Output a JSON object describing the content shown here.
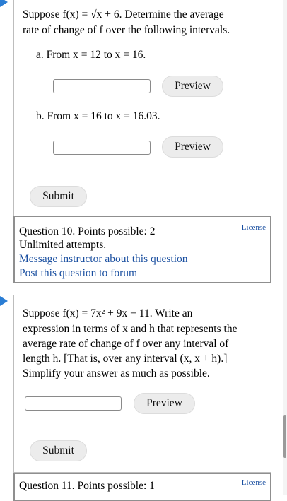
{
  "q9": {
    "intro_line1": "Suppose f(x) = √x + 6. Determine the average",
    "intro_line2": "rate of change of f over the following intervals.",
    "part_a": "a. From x = 12 to x = 16.",
    "part_b": "b. From x = 16 to x = 16.03.",
    "preview_label": "Preview",
    "submit_label": "Submit"
  },
  "q10": {
    "title": "Question 10. Points possible: 2",
    "attempts": "Unlimited attempts.",
    "message_link": "Message instructor about this question",
    "forum_link": "Post this question to forum",
    "license": "License"
  },
  "q11": {
    "lines": [
      "Suppose f(x) = 7x² + 9x − 11. Write an",
      "expression in terms of x and h that represents the",
      "average rate of change of f over any interval of",
      "length h. [That is, over any interval (x, x + h).]",
      "Simplify your answer as much as possible."
    ],
    "preview_label": "Preview",
    "submit_label": "Submit"
  },
  "q11_footer": {
    "title": "Question 11. Points possible: 1",
    "license": "License"
  },
  "colors": {
    "accent_arrow": "#2a7dd4",
    "link": "#1a4fa0"
  }
}
